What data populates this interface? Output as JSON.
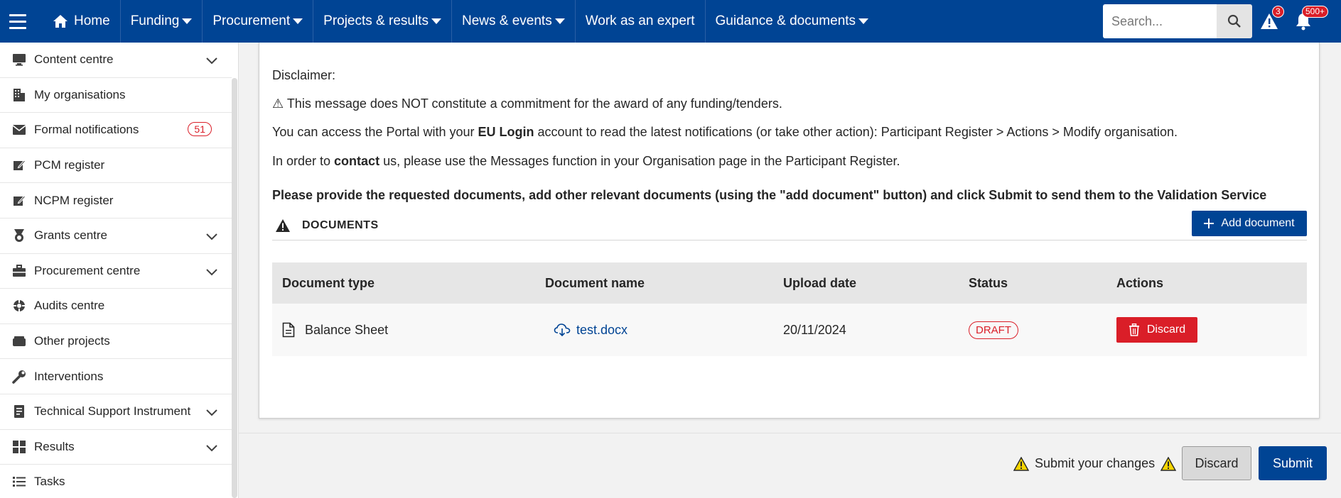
{
  "nav": {
    "home": "Home",
    "items": [
      {
        "label": "Funding",
        "dropdown": true
      },
      {
        "label": "Procurement",
        "dropdown": true
      },
      {
        "label": "Projects & results",
        "dropdown": true
      },
      {
        "label": "News & events",
        "dropdown": true
      },
      {
        "label": "Work as an expert",
        "dropdown": false
      },
      {
        "label": "Guidance & documents",
        "dropdown": true
      }
    ],
    "search_placeholder": "Search...",
    "alerts_count": "3",
    "notifications_count": "500+"
  },
  "sidebar": {
    "items": [
      {
        "label": "Content centre",
        "icon": "monitor-icon",
        "expandable": true
      },
      {
        "label": "My organisations",
        "icon": "building-icon",
        "expandable": false
      },
      {
        "label": "Formal notifications",
        "icon": "envelope-icon",
        "expandable": false,
        "count": "51"
      },
      {
        "label": "PCM register",
        "icon": "edit-icon",
        "expandable": false
      },
      {
        "label": "NCPM register",
        "icon": "edit-icon",
        "expandable": false
      },
      {
        "label": "Grants centre",
        "icon": "medal-icon",
        "expandable": true
      },
      {
        "label": "Procurement centre",
        "icon": "briefcase-icon",
        "expandable": true
      },
      {
        "label": "Audits centre",
        "icon": "audit-icon",
        "expandable": false
      },
      {
        "label": "Other projects",
        "icon": "box-icon",
        "expandable": false
      },
      {
        "label": "Interventions",
        "icon": "wrench-icon",
        "expandable": false
      },
      {
        "label": "Technical Support Instrument",
        "icon": "document-icon",
        "expandable": true
      },
      {
        "label": "Results",
        "icon": "grid-icon",
        "expandable": true
      },
      {
        "label": "Tasks",
        "icon": "list-icon",
        "expandable": false
      }
    ]
  },
  "content": {
    "disclaimer": "Disclaimer:",
    "warning_line": "⚠ This message does NOT constitute a commitment for the award of any funding/tenders.",
    "portal_pre": "You can access the Portal with your ",
    "portal_bold": "EU Login",
    "portal_post": " account to read the latest notifications (or take other action): Participant Register > Actions > Modify organisation.",
    "contact_pre": "In order to ",
    "contact_bold": "contact",
    "contact_post": " us, please use the Messages function in your Organisation page in the Participant Register.",
    "instruction": "Please provide the requested documents, add other relevant documents (using the \"add document\" button) and click Submit to send them to the Validation Service",
    "documents_label": "DOCUMENTS",
    "add_document": "Add document"
  },
  "table": {
    "headers": [
      "Document type",
      "Document name",
      "Upload date",
      "Status",
      "Actions"
    ],
    "rows": [
      {
        "type": "Balance Sheet",
        "name": "test.docx",
        "date": "20/11/2024",
        "status": "DRAFT",
        "action": "Discard"
      }
    ]
  },
  "footer": {
    "submit_message": "Submit your changes",
    "discard": "Discard",
    "submit": "Submit"
  },
  "colors": {
    "brand": "#004494",
    "danger": "#da1e28",
    "warning": "#f5d400"
  }
}
